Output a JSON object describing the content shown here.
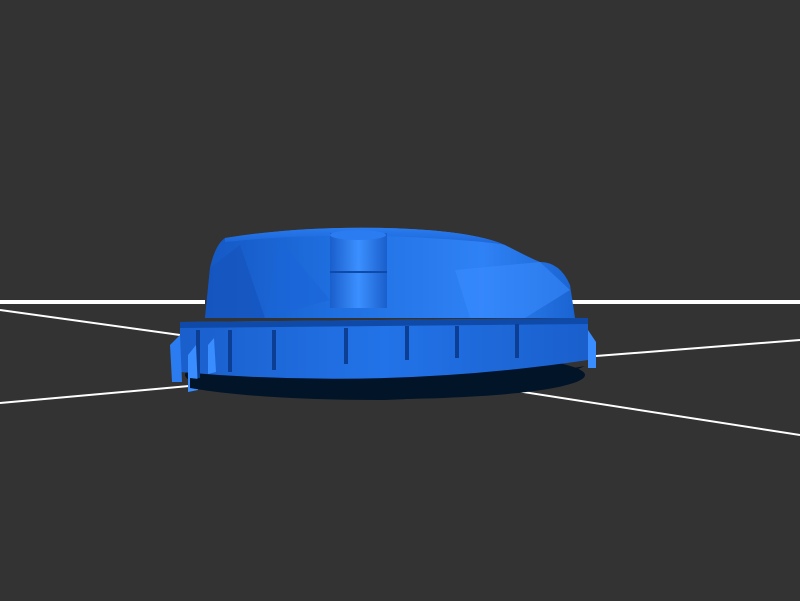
{
  "scene": {
    "background_color": "#333333",
    "grid_color": "#ffffff",
    "model_color": "#1f6fe0",
    "model_highlight_color": "#3d93ff",
    "model_shadow_color": "#0a2f6b",
    "model_base_color": "#021428"
  }
}
